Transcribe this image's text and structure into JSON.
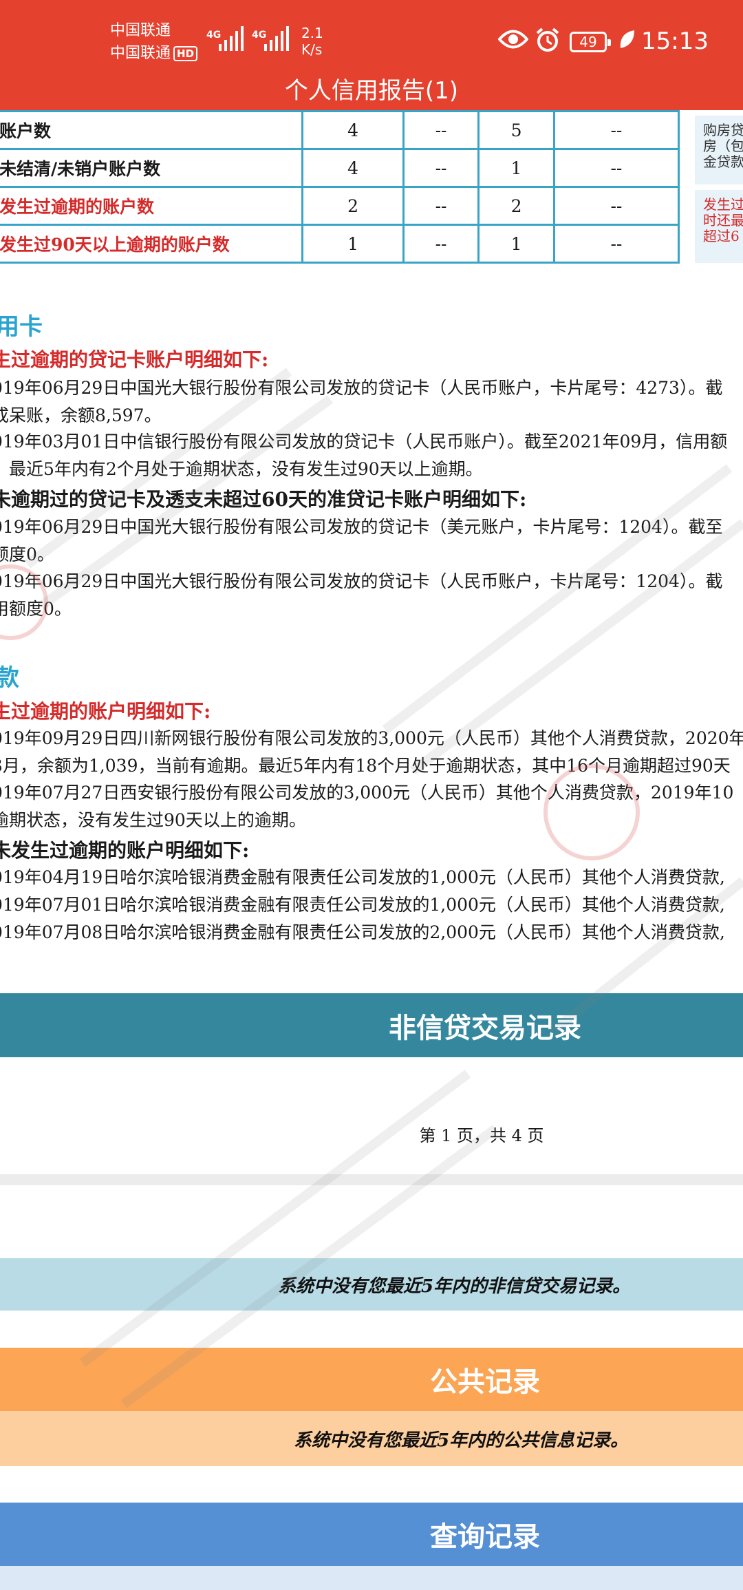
{
  "status_bar": {
    "carrier1": "中国联通",
    "carrier2": "中国联通",
    "hd": "HD",
    "network1": "4G",
    "network2": "4G",
    "speed_value": "2.1",
    "speed_unit": "K/s",
    "battery": "49",
    "time": "15:13"
  },
  "app": {
    "title": "个人信用报告(1)"
  },
  "summary_table": {
    "rows": [
      {
        "label": "账户数",
        "c1": "4",
        "c2": "--",
        "c3": "5",
        "c4": "--"
      },
      {
        "label": "未结清/未销户账户数",
        "c1": "4",
        "c2": "--",
        "c3": "1",
        "c4": "--"
      },
      {
        "label": "发生过逾期的账户数",
        "c1": "2",
        "c2": "--",
        "c3": "2",
        "c4": "--"
      },
      {
        "label": "发生过90天以上逾期的账户数",
        "c1": "1",
        "c2": "--",
        "c3": "1",
        "c4": "--"
      }
    ],
    "side_note_1": [
      "购房贷",
      "房（包",
      "金贷款"
    ],
    "side_note_2": [
      "发生过",
      "时还最",
      "超过6"
    ]
  },
  "credit_card": {
    "title": "用卡",
    "overdue_title": "生过逾期的贷记卡账户明细如下:",
    "overdue_items": [
      [
        "019年06月29日中国光大银行股份有限公司发放的贷记卡（人民币账户，卡片尾号：4273）。截",
        "成呆账，余额8,597。"
      ],
      [
        "019年03月01日中信银行股份有限公司发放的贷记卡（人民币账户）。截至2021年09月，信用额",
        "。最近5年内有2个月处于逾期状态，没有发生过90天以上逾期。"
      ]
    ],
    "normal_title": "未逾期过的贷记卡及透支未超过60天的准贷记卡账户明细如下:",
    "normal_items": [
      [
        "019年06月29日中国光大银行股份有限公司发放的贷记卡（美元账户，卡片尾号：1204）。截至",
        "额度0。"
      ],
      [
        "019年06月29日中国光大银行股份有限公司发放的贷记卡（人民币账户，卡片尾号：1204）。截",
        "用额度0。"
      ]
    ]
  },
  "loan": {
    "title": "款",
    "overdue_title": "生过逾期的账户明细如下:",
    "overdue_items": [
      [
        "019年09月29日四川新网银行股份有限公司发放的3,000元（人民币）其他个人消费贷款，2020年",
        "3月，余额为1,039，当前有逾期。最近5年内有18个月处于逾期状态，其中16个月逾期超过90天"
      ],
      [
        "019年07月27日西安银行股份有限公司发放的3,000元（人民币）其他个人消费贷款，2019年10",
        "逾期状态，没有发生过90天以上的逾期。"
      ]
    ],
    "normal_title": "未发生过逾期的账户明细如下:",
    "normal_items": [
      "019年04月19日哈尔滨哈银消费金融有限责任公司发放的1,000元（人民币）其他个人消费贷款,",
      "019年07月01日哈尔滨哈银消费金融有限责任公司发放的1,000元（人民币）其他个人消费贷款,",
      "019年07月08日哈尔滨哈银消费金融有限责任公司发放的2,000元（人民币）其他个人消费贷款,"
    ]
  },
  "non_credit": {
    "banner": "非信贷交易记录",
    "page_info": "第 1 页，共 4 页",
    "note": "系统中没有您最近5年内的非信贷交易记录。"
  },
  "public_records": {
    "banner": "公共记录",
    "note": "系统中没有您最近5年内的公共信息记录。"
  },
  "query_records": {
    "banner": "查询记录"
  }
}
